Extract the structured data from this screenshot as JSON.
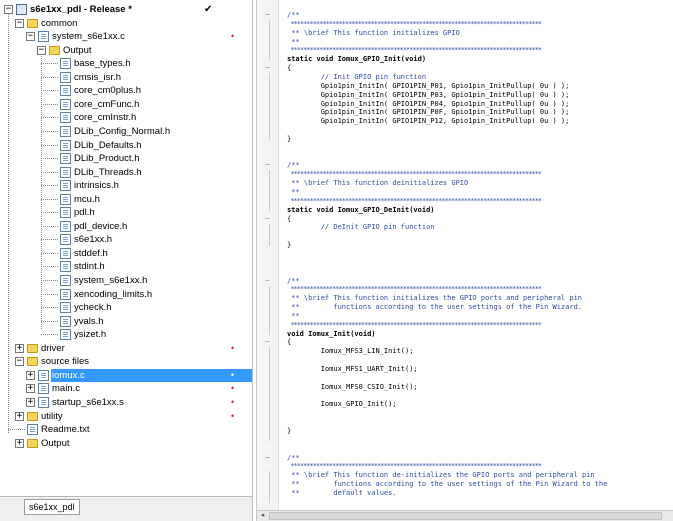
{
  "tree": {
    "project": {
      "label": "s6e1xx_pdl - Release *",
      "check": "✔"
    },
    "items": [
      {
        "label": "common",
        "kind": "folder",
        "expander": "−"
      },
      {
        "label": "system_s6e1xx.c",
        "kind": "file",
        "expander": "−",
        "mark": "•"
      },
      {
        "label": "Output",
        "kind": "folder",
        "expander": "−"
      },
      {
        "label": "base_types.h",
        "kind": "file"
      },
      {
        "label": "cmsis_isr.h",
        "kind": "file"
      },
      {
        "label": "core_cm0plus.h",
        "kind": "file"
      },
      {
        "label": "core_cmFunc.h",
        "kind": "file"
      },
      {
        "label": "core_cmInstr.h",
        "kind": "file"
      },
      {
        "label": "DLib_Config_Normal.h",
        "kind": "file"
      },
      {
        "label": "DLib_Defaults.h",
        "kind": "file"
      },
      {
        "label": "DLib_Product.h",
        "kind": "file"
      },
      {
        "label": "DLib_Threads.h",
        "kind": "file"
      },
      {
        "label": "intrinsics.h",
        "kind": "file"
      },
      {
        "label": "mcu.h",
        "kind": "file"
      },
      {
        "label": "pdl.h",
        "kind": "file"
      },
      {
        "label": "pdl_device.h",
        "kind": "file"
      },
      {
        "label": "s6e1xx.h",
        "kind": "file"
      },
      {
        "label": "stddef.h",
        "kind": "file"
      },
      {
        "label": "stdint.h",
        "kind": "file"
      },
      {
        "label": "system_s6e1xx.h",
        "kind": "file"
      },
      {
        "label": "xencoding_limits.h",
        "kind": "file"
      },
      {
        "label": "ycheck.h",
        "kind": "file"
      },
      {
        "label": "yvals.h",
        "kind": "file"
      },
      {
        "label": "ysizet.h",
        "kind": "file"
      },
      {
        "label": "driver",
        "kind": "folder",
        "expander": "+",
        "mark": "•"
      },
      {
        "label": "source files",
        "kind": "folder",
        "expander": "−"
      },
      {
        "label": "iomux.c",
        "kind": "file",
        "expander": "+",
        "mark": "•",
        "selected": true
      },
      {
        "label": "main.c",
        "kind": "file",
        "expander": "+",
        "mark": "•"
      },
      {
        "label": "startup_s6e1xx.s",
        "kind": "file",
        "expander": "+",
        "mark": "•"
      },
      {
        "label": "utility",
        "kind": "folder",
        "expander": "+",
        "mark": "•"
      },
      {
        "label": "Readme.txt",
        "kind": "file"
      },
      {
        "label": "Output",
        "kind": "folder",
        "expander": "+"
      }
    ],
    "bottom_tab": "s6e1xx_pdl"
  },
  "editor": {
    "lines": [
      {
        "t": "/**",
        "c": "cm"
      },
      {
        "t": " ******************************************************************************",
        "c": "sep"
      },
      {
        "t": " ** \\brief This function initializes GPIO",
        "c": "cm"
      },
      {
        "t": " **",
        "c": "cm"
      },
      {
        "t": " ******************************************************************************",
        "c": "sep"
      },
      {
        "t": "static void Iomux_GPIO_Init(void)",
        "c": "kw"
      },
      {
        "t": "{",
        "c": ""
      },
      {
        "t": "        // Init GPIO pin function",
        "c": "cm"
      },
      {
        "t": "        Gpio1pin_InitIn( GPIO1PIN_P01, Gpio1pin_InitPullup( 0u ) );",
        "c": ""
      },
      {
        "t": "        Gpio1pin_InitIn( GPIO1PIN_P03, Gpio1pin_InitPullup( 0u ) );",
        "c": ""
      },
      {
        "t": "        Gpio1pin_InitIn( GPIO1PIN_P04, Gpio1pin_InitPullup( 0u ) );",
        "c": ""
      },
      {
        "t": "        Gpio1pin_InitIn( GPIO1PIN_P0F, Gpio1pin_InitPullup( 0u ) );",
        "c": ""
      },
      {
        "t": "        Gpio1pin_InitIn( GPIO1PIN_P12, Gpio1pin_InitPullup( 0u ) );",
        "c": ""
      },
      {
        "t": "",
        "c": ""
      },
      {
        "t": "}",
        "c": ""
      },
      {
        "t": "",
        "c": ""
      },
      {
        "t": "",
        "c": ""
      },
      {
        "t": "/**",
        "c": "cm"
      },
      {
        "t": " ******************************************************************************",
        "c": "sep"
      },
      {
        "t": " ** \\brief This function deinitializes GPIO",
        "c": "cm"
      },
      {
        "t": " **",
        "c": "cm"
      },
      {
        "t": " ******************************************************************************",
        "c": "sep"
      },
      {
        "t": "static void Iomux_GPIO_DeInit(void)",
        "c": "kw"
      },
      {
        "t": "{",
        "c": ""
      },
      {
        "t": "        // DeInit GPIO pin function",
        "c": "cm"
      },
      {
        "t": "",
        "c": ""
      },
      {
        "t": "}",
        "c": ""
      },
      {
        "t": "",
        "c": ""
      },
      {
        "t": "",
        "c": ""
      },
      {
        "t": "",
        "c": ""
      },
      {
        "t": "/**",
        "c": "cm"
      },
      {
        "t": " ******************************************************************************",
        "c": "sep"
      },
      {
        "t": " ** \\brief This function initializes the GPIO ports and peripheral pin",
        "c": "cm"
      },
      {
        "t": " **        functions according to the user settings of the Pin Wizard.",
        "c": "cm"
      },
      {
        "t": " **",
        "c": "cm"
      },
      {
        "t": " ******************************************************************************",
        "c": "sep"
      },
      {
        "t": "void Iomux_Init(void)",
        "c": "kw"
      },
      {
        "t": "{",
        "c": ""
      },
      {
        "t": "        Iomux_MFS3_LIN_Init();",
        "c": ""
      },
      {
        "t": "",
        "c": ""
      },
      {
        "t": "        Iomux_MFS1_UART_Init();",
        "c": ""
      },
      {
        "t": "",
        "c": ""
      },
      {
        "t": "        Iomux_MFS0_CSIO_Init();",
        "c": ""
      },
      {
        "t": "",
        "c": ""
      },
      {
        "t": "        Iomux_GPIO_Init();",
        "c": ""
      },
      {
        "t": "",
        "c": ""
      },
      {
        "t": "",
        "c": ""
      },
      {
        "t": "}",
        "c": ""
      },
      {
        "t": "",
        "c": ""
      },
      {
        "t": "",
        "c": ""
      },
      {
        "t": "/**",
        "c": "cm"
      },
      {
        "t": " ******************************************************************************",
        "c": "sep"
      },
      {
        "t": " ** \\brief This function de-initializes the GPIO ports and peripheral pin",
        "c": "cm"
      },
      {
        "t": " **        functions according to the user settings of the Pin Wizard to the",
        "c": "cm"
      },
      {
        "t": " **        default values.",
        "c": "cm"
      }
    ]
  },
  "colors": {
    "selection": "#3399ff",
    "comment": "#2e4ea8",
    "folder": "#f6d35c",
    "mark": "#d4222c"
  }
}
